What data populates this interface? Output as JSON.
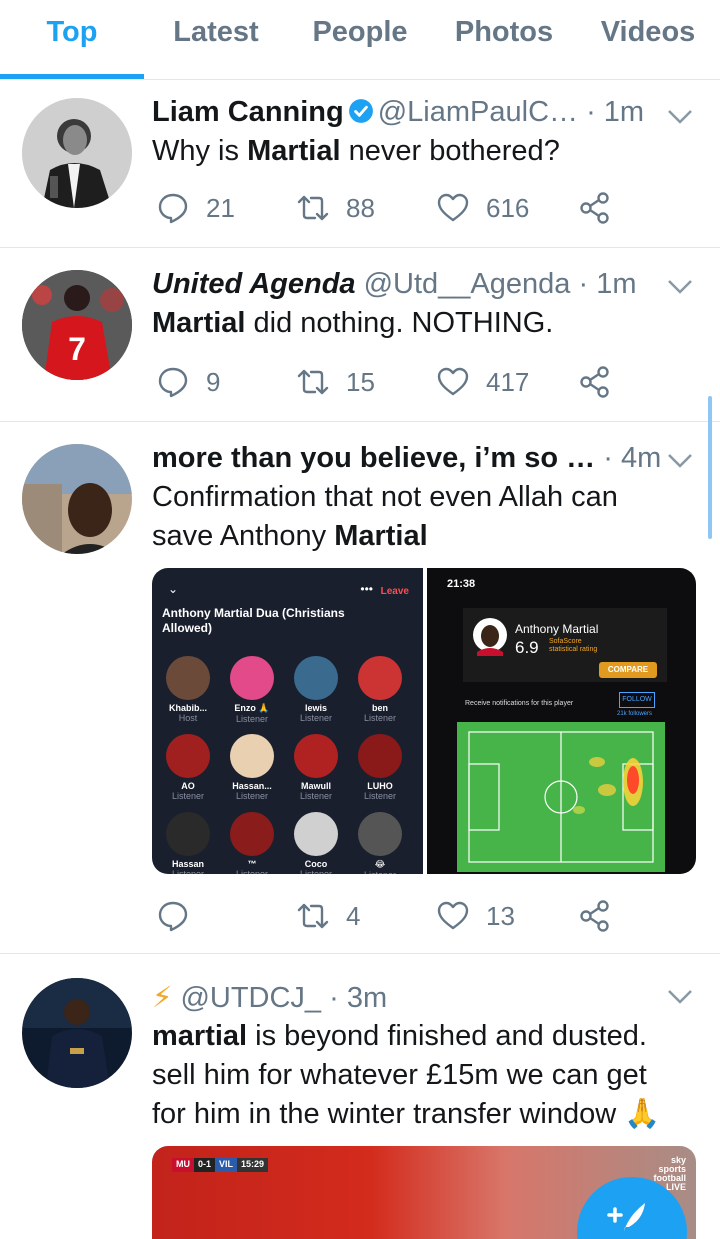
{
  "tabs": [
    {
      "label": "Top",
      "active": true
    },
    {
      "label": "Latest",
      "active": false
    },
    {
      "label": "People",
      "active": false
    },
    {
      "label": "Photos",
      "active": false
    },
    {
      "label": "Videos",
      "active": false
    }
  ],
  "tweets": [
    {
      "name": "Liam Canning",
      "verified": true,
      "handle": "@LiamPaulC…",
      "time": "· 1m",
      "text_parts": [
        {
          "t": "Why is ",
          "b": false
        },
        {
          "t": "Martial",
          "b": true
        },
        {
          "t": " never bothered?",
          "b": false
        }
      ],
      "replies": "21",
      "retweets": "88",
      "likes": "616"
    },
    {
      "name": "United Agenda",
      "handle": "@Utd__Agenda",
      "time": "· 1m",
      "text_parts": [
        {
          "t": "Martial",
          "b": true
        },
        {
          "t": " did nothing. NOTHING.",
          "b": false
        }
      ],
      "replies": "9",
      "retweets": "15",
      "likes": "417"
    },
    {
      "name": "more than you believe, i’m so …",
      "time": "· 4m",
      "text_line1": "Confirmation that not even Allah can",
      "text_line2_a": "save Anthony ",
      "text_line2_b": "Martial",
      "replies": "",
      "retweets": "4",
      "likes": "13",
      "media": {
        "room_title": "Anthony Martial Dua (Christians Allowed)",
        "leave_label": "Leave",
        "dots": "•••",
        "people": [
          {
            "name": "Khabib...",
            "role": "Host"
          },
          {
            "name": "Enzo 🙏",
            "role": "Listener"
          },
          {
            "name": "lewis",
            "role": "Listener"
          },
          {
            "name": "ben",
            "role": "Listener"
          },
          {
            "name": "AO",
            "role": "Listener"
          },
          {
            "name": "Hassan...",
            "role": "Listener"
          },
          {
            "name": "Mawull",
            "role": "Listener"
          },
          {
            "name": "LUHO",
            "role": "Listener"
          },
          {
            "name": "Hassan",
            "role": "Listener"
          },
          {
            "name": "™",
            "role": "Listener"
          },
          {
            "name": "Coco",
            "role": "Listener"
          },
          {
            "name": "😂",
            "role": "Listener"
          }
        ],
        "clock": "21:38",
        "player_name": "Anthony Martial",
        "rating": "6.9",
        "sofascore": "SofaScore statistical rating",
        "compare": "COMPARE",
        "notify": "Receive notifications for this player",
        "follow": "FOLLOW",
        "followers": "21k followers"
      }
    },
    {
      "emoji": "⚡",
      "handle": "@UTDCJ_",
      "time": "· 3m",
      "text_a": "martial",
      "text_b": " is beyond finished and dusted.",
      "text_line2": "sell him for whatever £15m we can get",
      "text_line3": "for him in the winter transfer window 🙏",
      "video": {
        "score_team1": "MU",
        "score": "0-1",
        "score_team2": "VIL",
        "clock": "15:29",
        "channel": "sky sports football LIVE"
      }
    }
  ],
  "colors": {
    "accent": "#1da1f2",
    "muted": "#657786",
    "text": "#14171a"
  }
}
